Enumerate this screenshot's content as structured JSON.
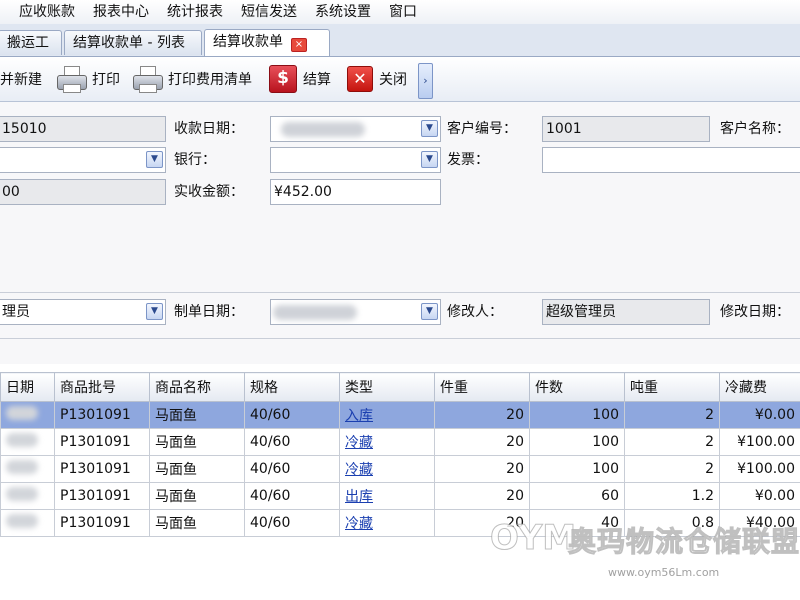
{
  "menu": [
    "应收账款",
    "报表中心",
    "统计报表",
    "短信发送",
    "系统设置",
    "窗口"
  ],
  "tabs": [
    {
      "label": "搬运工"
    },
    {
      "label": "结算收款单 - 列表"
    },
    {
      "label": "结算收款单",
      "active": true,
      "close": "×"
    }
  ],
  "toolbar": {
    "new_label": "并新建",
    "print_label": "打印",
    "print_fee_label": "打印费用清单",
    "settle_label": "结算",
    "close_label": "关闭",
    "more": "›",
    "icons": {
      "print": "printer-icon",
      "settle": "dollar-icon",
      "close": "close-icon"
    }
  },
  "form": {
    "row1": {
      "doc_no_value": "15010",
      "receipt_date_label": "收款日期：",
      "customer_no_label": "客户编号：",
      "customer_no_value": "1001",
      "customer_name_label": "客户名称："
    },
    "row2": {
      "bank_label": "银行：",
      "invoice_label": "发票："
    },
    "row3": {
      "partial_value": "00",
      "actual_amount_label": "实收金额：",
      "actual_amount_value": "¥452.00"
    },
    "row4": {
      "creator_value": "理员",
      "created_date_label": "制单日期：",
      "modifier_label": "修改人：",
      "modifier_value": "超级管理员",
      "modified_date_label": "修改日期："
    }
  },
  "grid": {
    "columns": [
      "日期",
      "商品批号",
      "商品名称",
      "规格",
      "类型",
      "件重",
      "件数",
      "吨重",
      "冷藏费"
    ],
    "rows": [
      {
        "batch": "P1301091",
        "name": "马面鱼",
        "spec": "40/60",
        "type": "入库",
        "piece_weight": "20",
        "count": "100",
        "tons": "2",
        "fee": "¥0.00",
        "selected": true
      },
      {
        "batch": "P1301091",
        "name": "马面鱼",
        "spec": "40/60",
        "type": "冷藏",
        "piece_weight": "20",
        "count": "100",
        "tons": "2",
        "fee": "¥100.00"
      },
      {
        "batch": "P1301091",
        "name": "马面鱼",
        "spec": "40/60",
        "type": "冷藏",
        "piece_weight": "20",
        "count": "100",
        "tons": "2",
        "fee": "¥100.00"
      },
      {
        "batch": "P1301091",
        "name": "马面鱼",
        "spec": "40/60",
        "type": "出库",
        "piece_weight": "20",
        "count": "60",
        "tons": "1.2",
        "fee": "¥0.00"
      },
      {
        "batch": "P1301091",
        "name": "马面鱼",
        "spec": "40/60",
        "type": "冷藏",
        "piece_weight": "20",
        "count": "40",
        "tons": "0.8",
        "fee": "¥40.00"
      }
    ]
  },
  "watermark": {
    "logo": "OYM",
    "name": "奥玛物流仓储联盟",
    "url": "www.oym56Lm.com"
  }
}
